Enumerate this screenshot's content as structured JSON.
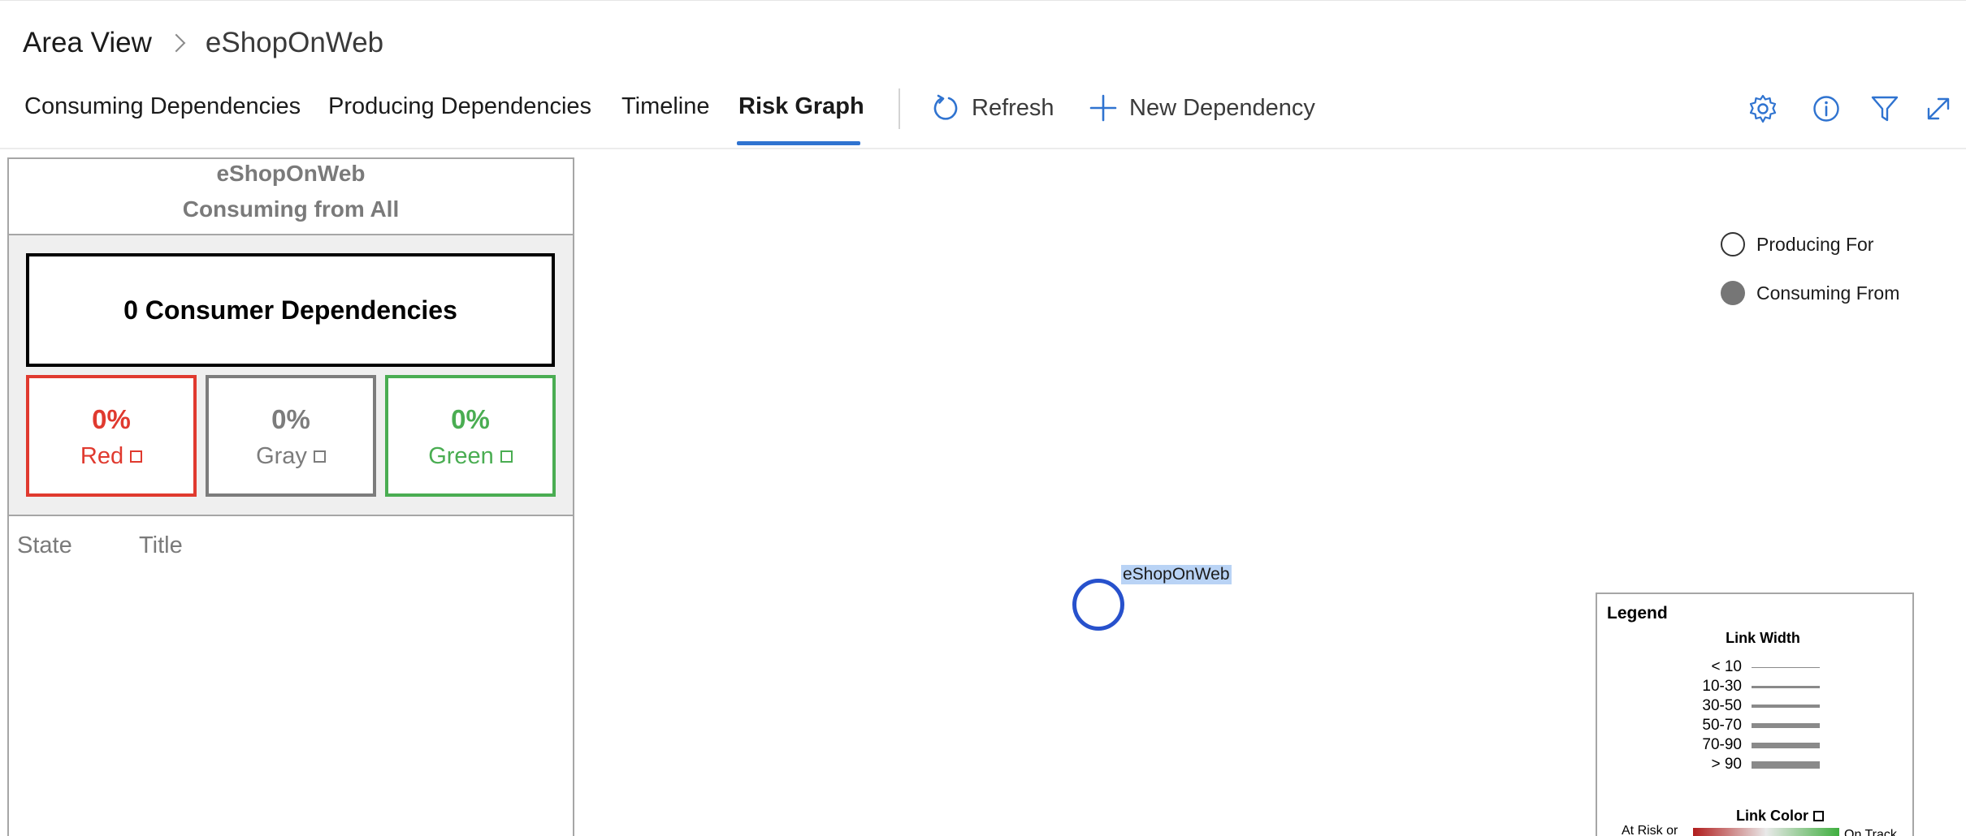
{
  "breadcrumb": {
    "root": "Area View",
    "current": "eShopOnWeb"
  },
  "tabs": [
    {
      "label": "Consuming Dependencies",
      "active": false
    },
    {
      "label": "Producing Dependencies",
      "active": false
    },
    {
      "label": "Timeline",
      "active": false
    },
    {
      "label": "Risk Graph",
      "active": true
    }
  ],
  "toolbar": {
    "refresh_label": "Refresh",
    "new_dependency_label": "New Dependency",
    "right_icons": [
      "gear-icon",
      "info-icon",
      "filter-icon",
      "expand-icon"
    ]
  },
  "summary_panel": {
    "title": "eShopOnWeb",
    "subtitle": "Consuming from All",
    "consumer_count_text": "0 Consumer Dependencies",
    "stats": [
      {
        "percent": "0%",
        "label": "Red",
        "color": "#e03a2f"
      },
      {
        "percent": "0%",
        "label": "Gray",
        "color": "#7c7c7c"
      },
      {
        "percent": "0%",
        "label": "Green",
        "color": "#4aad52"
      }
    ],
    "columns": [
      "State",
      "Title"
    ]
  },
  "graph": {
    "node_label": "eShopOnWeb",
    "node_color": "#2751cc",
    "key": [
      {
        "label": "Producing For",
        "style": "hollow"
      },
      {
        "label": "Consuming From",
        "style": "filled",
        "color": "#767676"
      }
    ],
    "legend": {
      "title": "Legend",
      "link_width_title": "Link Width",
      "link_widths": [
        "< 10",
        "10-30",
        "30-50",
        "50-70",
        "70-90",
        "> 90"
      ],
      "link_color_title": "Link Color",
      "at_risk_label": "At Risk or",
      "on_track_label": "On Track"
    }
  }
}
